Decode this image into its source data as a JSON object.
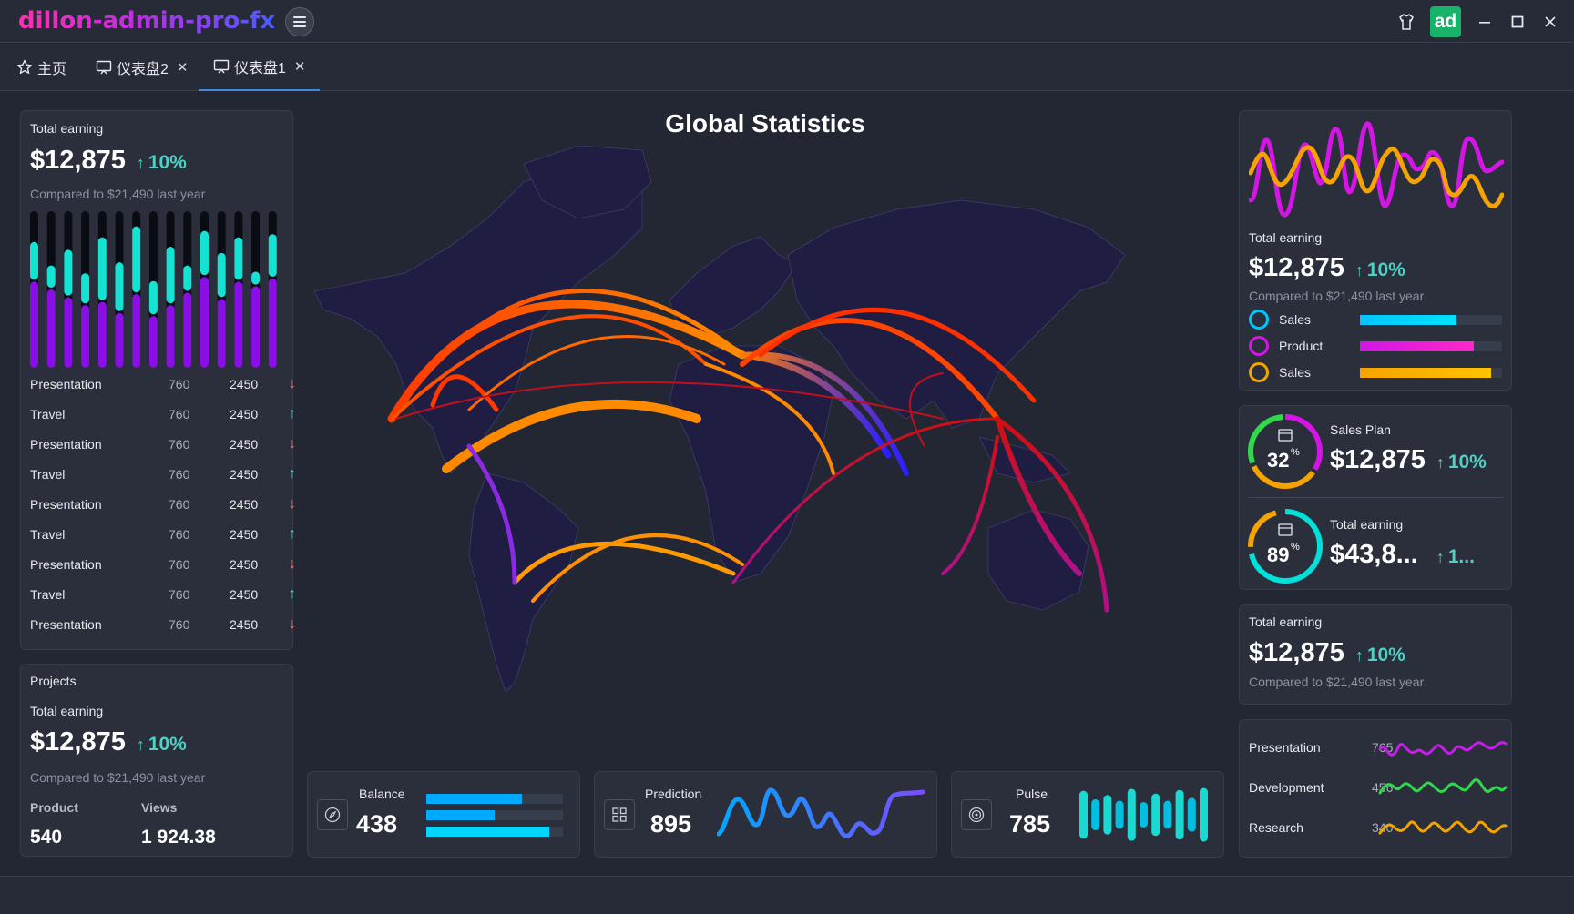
{
  "app": {
    "title": "dillon-admin-pro-fx",
    "avatar_text": "ad"
  },
  "tabs": [
    {
      "label": "主页",
      "icon": "star-icon"
    },
    {
      "label": "仪表盘2",
      "icon": "monitor-icon"
    },
    {
      "label": "仪表盘1",
      "icon": "monitor-icon"
    }
  ],
  "left_card": {
    "title": "Total earning",
    "value": "$12,875",
    "pct": "10%",
    "compare": "Compared to $21,490 last year",
    "bars": [
      {
        "top": 0.85,
        "bottom": 0.55
      },
      {
        "top": 0.7,
        "bottom": 0.5
      },
      {
        "top": 0.8,
        "bottom": 0.45
      },
      {
        "top": 0.65,
        "bottom": 0.4
      },
      {
        "top": 0.88,
        "bottom": 0.42
      },
      {
        "top": 0.72,
        "bottom": 0.35
      },
      {
        "top": 0.95,
        "bottom": 0.47
      },
      {
        "top": 0.6,
        "bottom": 0.33
      },
      {
        "top": 0.82,
        "bottom": 0.4
      },
      {
        "top": 0.7,
        "bottom": 0.48
      },
      {
        "top": 0.92,
        "bottom": 0.58
      },
      {
        "top": 0.78,
        "bottom": 0.44
      },
      {
        "top": 0.88,
        "bottom": 0.55
      },
      {
        "top": 0.66,
        "bottom": 0.52
      },
      {
        "top": 0.9,
        "bottom": 0.57
      }
    ],
    "rows": [
      {
        "name": "Presentation",
        "a": "760",
        "b": "2450",
        "dir": "down"
      },
      {
        "name": "Travel",
        "a": "760",
        "b": "2450",
        "dir": "up"
      },
      {
        "name": "Presentation",
        "a": "760",
        "b": "2450",
        "dir": "down"
      },
      {
        "name": "Travel",
        "a": "760",
        "b": "2450",
        "dir": "up"
      },
      {
        "name": "Presentation",
        "a": "760",
        "b": "2450",
        "dir": "down"
      },
      {
        "name": "Travel",
        "a": "760",
        "b": "2450",
        "dir": "up"
      },
      {
        "name": "Presentation",
        "a": "760",
        "b": "2450",
        "dir": "down"
      },
      {
        "name": "Travel",
        "a": "760",
        "b": "2450",
        "dir": "up"
      },
      {
        "name": "Presentation",
        "a": "760",
        "b": "2450",
        "dir": "down"
      }
    ]
  },
  "projects_card": {
    "title": "Projects",
    "subtitle": "Total earning",
    "value": "$12,875",
    "pct": "10%",
    "compare": "Compared to $21,490 last year",
    "col1_label": "Product",
    "col2_label": "Views",
    "col1_value": "540",
    "col2_value": "1 924.38"
  },
  "map": {
    "title": "Global Statistics"
  },
  "stats": [
    {
      "label": "Balance",
      "value": "438",
      "icon": "compass-icon",
      "bars": [
        0.7,
        0.5,
        0.9
      ]
    },
    {
      "label": "Prediction",
      "value": "895",
      "icon": "grid-icon"
    },
    {
      "label": "Pulse",
      "value": "785",
      "icon": "target-icon"
    }
  ],
  "right_top": {
    "title": "Total earning",
    "value": "$12,875",
    "pct": "10%",
    "compare": "Compared to $21,490 last year",
    "legend": [
      {
        "label": "Sales",
        "color": "#00c6ff",
        "level": 0.68
      },
      {
        "label": "Product",
        "color": "#d316e6",
        "level": 0.8
      },
      {
        "label": "Sales",
        "color": "#f5a300",
        "level": 0.92
      }
    ]
  },
  "sales_plan": {
    "title": "Sales Plan",
    "value": "$12,875",
    "pct": "10%",
    "ring": "32",
    "ring_unit": "%",
    "title2": "Total earning",
    "value2": "$43,8...",
    "pct2": "1...",
    "ring2": "89",
    "ring2_unit": "%"
  },
  "right_mid": {
    "title": "Total earning",
    "value": "$12,875",
    "pct": "10%",
    "compare": "Compared to $21,490 last year"
  },
  "right_bottom": [
    {
      "label": "Presentation",
      "value": "765",
      "color": "#c41ee8"
    },
    {
      "label": "Development",
      "value": "456",
      "color": "#2fd94a"
    },
    {
      "label": "Research",
      "value": "340",
      "color": "#f5a300"
    }
  ]
}
